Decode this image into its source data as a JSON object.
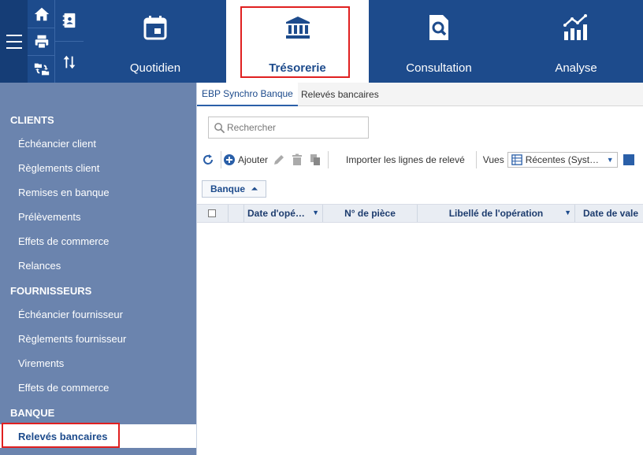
{
  "nav": {
    "tabs": [
      {
        "label": "Quotidien",
        "icon": "calendar-icon"
      },
      {
        "label": "Trésorerie",
        "icon": "bank-icon"
      },
      {
        "label": "Consultation",
        "icon": "search-document-icon"
      },
      {
        "label": "Analyse",
        "icon": "chart-icon"
      }
    ],
    "active_tab": "Trésorerie",
    "quick_icons": [
      "home-icon",
      "contacts-icon",
      "print-icon",
      "sort-icon",
      "sync-folders-icon"
    ]
  },
  "sidebar": {
    "sections": [
      {
        "title": "CLIENTS",
        "items": [
          "Échéancier client",
          "Règlements client",
          "Remises en banque",
          "Prélèvements",
          "Effets de commerce",
          "Relances"
        ]
      },
      {
        "title": "FOURNISSEURS",
        "items": [
          "Échéancier fournisseur",
          "Règlements fournisseur",
          "Virements",
          "Effets de commerce"
        ]
      },
      {
        "title": "BANQUE",
        "items": [
          "Relevés bancaires"
        ]
      }
    ],
    "active_item": "Relevés bancaires"
  },
  "main": {
    "subtabs": [
      "EBP Synchro Banque",
      "Relevés bancaires"
    ],
    "active_subtab": "EBP Synchro Banque",
    "search_placeholder": "Rechercher",
    "toolbar": {
      "add_label": "Ajouter",
      "import_label": "Importer les lignes de relevé",
      "views_label": "Vues",
      "views_value": "Récentes (Syst…"
    },
    "group_button": "Banque",
    "columns": [
      "Date d'opé…",
      "N° de pièce",
      "Libellé de l'opération",
      "Date de vale"
    ]
  },
  "colors": {
    "brand": "#1d4b8c",
    "sidebar": "#6b84ae",
    "highlight": "#e02020"
  }
}
